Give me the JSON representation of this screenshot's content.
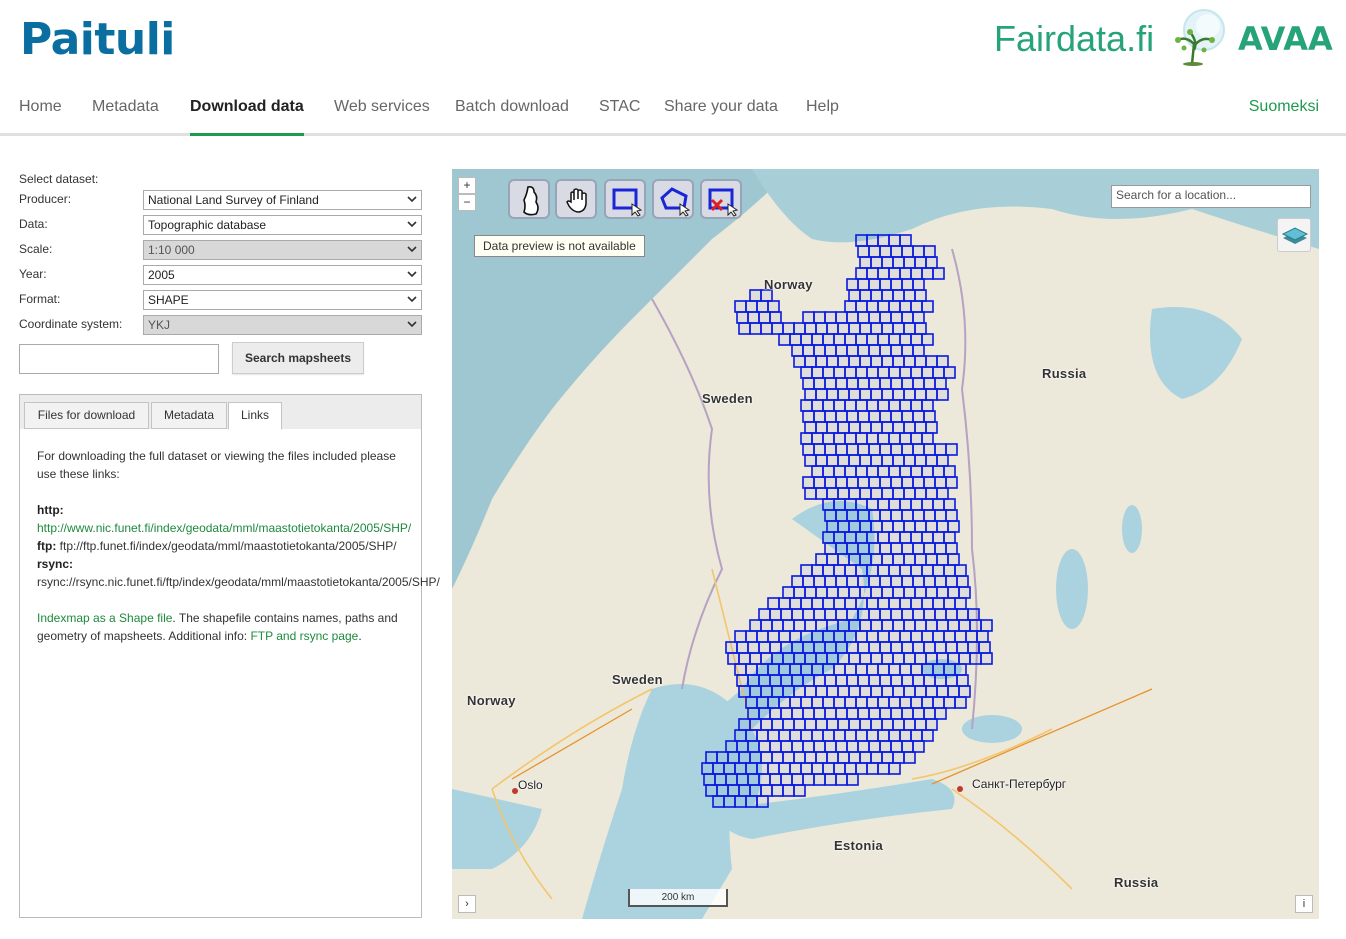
{
  "header": {
    "brand": "Paituli",
    "fairdata": "Fairdata.fi",
    "avaa": "AVAA"
  },
  "nav": {
    "items": [
      "Home",
      "Metadata",
      "Download data",
      "Web services",
      "Batch download",
      "STAC",
      "Share your data",
      "Help"
    ],
    "active": "Download data",
    "language": "Suomeksi"
  },
  "form": {
    "title": "Select dataset:",
    "rows": [
      {
        "label": "Producer:",
        "value": "National Land Survey of Finland",
        "disabled": false
      },
      {
        "label": "Data:",
        "value": "Topographic database",
        "disabled": false
      },
      {
        "label": "Scale:",
        "value": "1:10 000",
        "disabled": true
      },
      {
        "label": "Year:",
        "value": "2005",
        "disabled": false
      },
      {
        "label": "Format:",
        "value": "SHAPE",
        "disabled": false
      },
      {
        "label": "Coordinate system:",
        "value": "YKJ",
        "disabled": true
      }
    ],
    "search_value": "",
    "search_button": "Search mapsheets"
  },
  "tabs": {
    "items": [
      "Files for download",
      "Metadata",
      "Links"
    ],
    "active": "Links"
  },
  "links": {
    "intro": "For downloading the full dataset or viewing the files included please use these links:",
    "http_label": "http:",
    "http_url": "http://www.nic.funet.fi/index/geodata/mml/maastotietokanta/2005/SHP/",
    "ftp_label": "ftp:",
    "ftp_url": "ftp://ftp.funet.fi/index/geodata/mml/maastotietokanta/2005/SHP/",
    "rsync_label": "rsync:",
    "rsync_url": "rsync://rsync.nic.funet.fi/ftp/index/geodata/mml/maastotietokanta/2005/SHP/",
    "indexmap_link": "Indexmap as a Shape file",
    "indexmap_text": ". The shapefile contains names, paths and geometry of mapsheets. Additional info: ",
    "ftp_rsync_link": "FTP and rsync page",
    "end": "."
  },
  "map": {
    "zoom_in": "+",
    "zoom_out": "−",
    "tooltip": "Data preview is not available",
    "search_placeholder": "Search for a location...",
    "labels": [
      "Norway",
      "Russia",
      "Sweden",
      "Sweden",
      "Norway",
      "Estonia",
      "Russia"
    ],
    "cities": [
      "Oslo",
      "Санкт-Петербург"
    ],
    "scale": "200 km",
    "expand": "›",
    "info": "i",
    "grid_color": "#0a1adf",
    "tools": [
      "finland-tool-icon",
      "pan-tool-icon",
      "select-rectangle-icon",
      "select-polygon-icon",
      "clear-selection-icon"
    ]
  }
}
